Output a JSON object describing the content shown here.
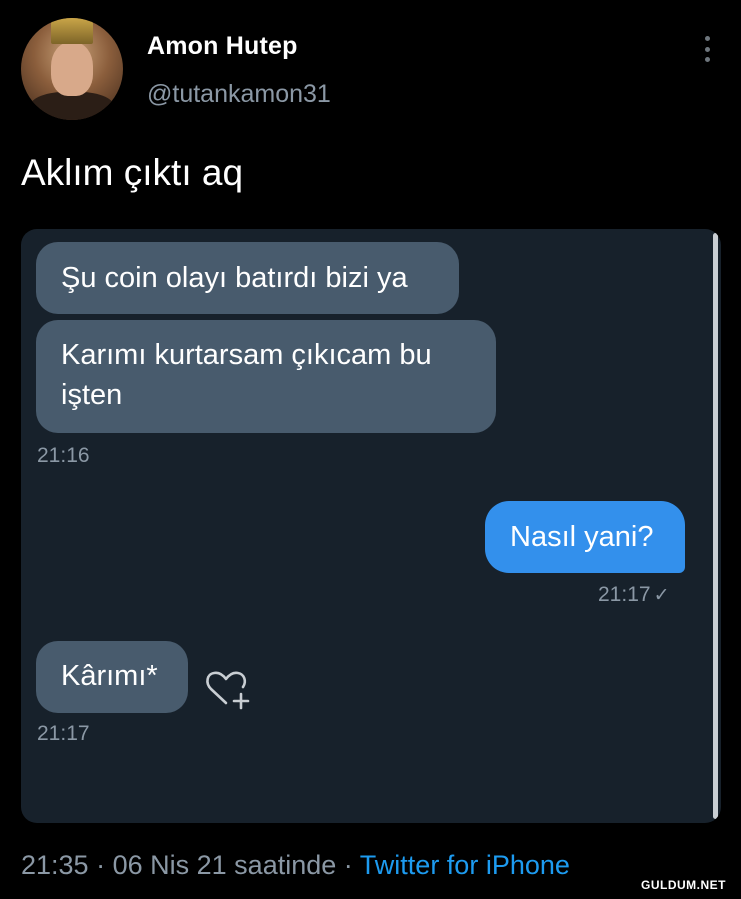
{
  "author": {
    "display_name": "Amon Hutep",
    "handle": "@tutankamon31"
  },
  "tweet": {
    "text": "Aklım çıktı aq"
  },
  "media": {
    "messages": [
      {
        "direction": "incoming",
        "text": "Şu coin olayı batırdı bizi ya"
      },
      {
        "direction": "incoming",
        "text": "Karımı kurtarsam çıkıcam bu işten"
      },
      {
        "direction": "outgoing",
        "text": "Nasıl yani?"
      },
      {
        "direction": "incoming",
        "text": "Kârımı*"
      }
    ],
    "timestamps": [
      "21:16",
      "21:17",
      "21:17"
    ],
    "read_check": "✓",
    "reaction_icon": "heart-plus-icon"
  },
  "footer": {
    "time": "21:35",
    "date": "06 Nis 21 saatinde",
    "source": "Twitter for iPhone"
  },
  "watermark": "GULDUM.NET",
  "colors": {
    "background": "#000000",
    "incoming_bubble": "#485b6d",
    "outgoing_bubble": "#3390ec",
    "link": "#1d9bf0"
  }
}
